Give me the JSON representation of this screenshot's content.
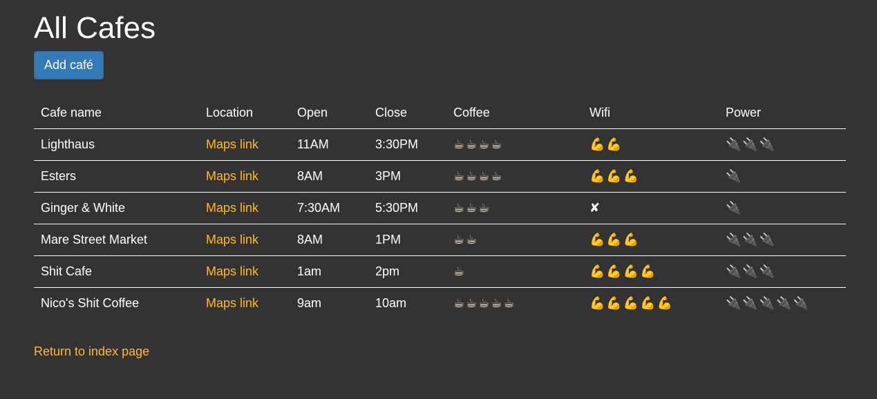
{
  "page": {
    "title": "All Cafes",
    "add_button_label": "Add café",
    "return_link_label": "Return to index page"
  },
  "table": {
    "headers": [
      "Cafe name",
      "Location",
      "Open",
      "Close",
      "Coffee",
      "Wifi",
      "Power"
    ],
    "rows": [
      {
        "name": "Lighthaus",
        "location": "Maps link",
        "open": "11AM",
        "close": "3:30PM",
        "coffee": "☕☕☕☕",
        "wifi": "💪💪",
        "power": "🔌🔌🔌"
      },
      {
        "name": "Esters",
        "location": "Maps link",
        "open": "8AM",
        "close": "3PM",
        "coffee": "☕☕☕☕",
        "wifi": "💪💪💪",
        "power": "🔌"
      },
      {
        "name": "Ginger & White",
        "location": "Maps link",
        "open": "7:30AM",
        "close": "5:30PM",
        "coffee": "☕☕☕",
        "wifi": "✘",
        "power": "🔌"
      },
      {
        "name": "Mare Street Market",
        "location": "Maps link",
        "open": "8AM",
        "close": "1PM",
        "coffee": "☕☕",
        "wifi": "💪💪💪",
        "power": "🔌🔌🔌"
      },
      {
        "name": "Shit Cafe",
        "location": "Maps link",
        "open": "1am",
        "close": "2pm",
        "coffee": "☕",
        "wifi": "💪💪💪💪",
        "power": "🔌🔌🔌"
      },
      {
        "name": "Nico's Shit Coffee",
        "location": "Maps link",
        "open": "9am",
        "close": "10am",
        "coffee": "☕☕☕☕☕",
        "wifi": "💪💪💪💪💪",
        "power": "🔌🔌🔌🔌🔌"
      }
    ]
  },
  "colors": {
    "background": "#333333",
    "text": "#ffffff",
    "link": "#ffb833",
    "button": "#337ab7"
  },
  "icons": {
    "coffee": "coffee-cup-icon",
    "wifi": "flexed-bicep-icon",
    "power": "electric-plug-icon",
    "no_wifi": "cross-mark-icon"
  }
}
